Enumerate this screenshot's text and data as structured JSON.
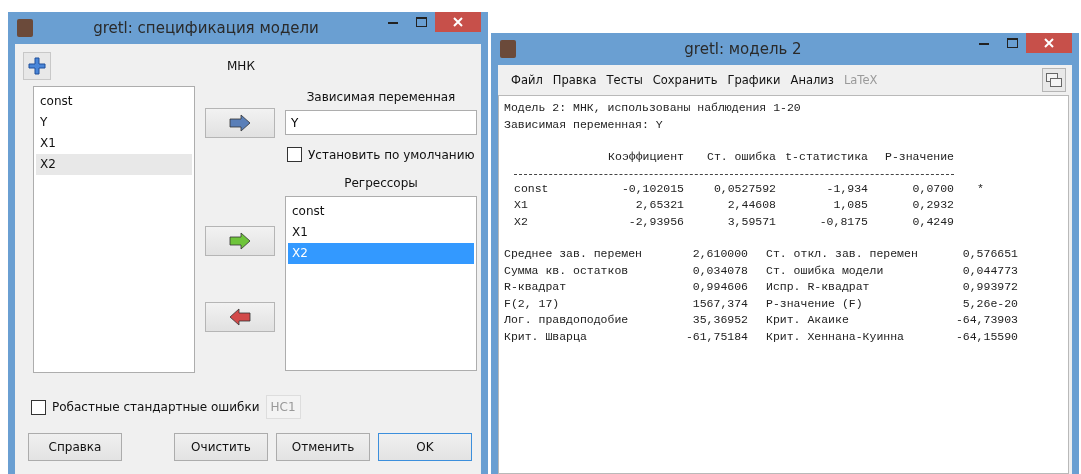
{
  "spec_window": {
    "title": "gretl: спецификация модели",
    "method": "МНК",
    "variables": [
      {
        "label": "const",
        "selected": false
      },
      {
        "label": "Y",
        "selected": false
      },
      {
        "label": "X1",
        "selected": false
      },
      {
        "label": "X2",
        "selected": true
      }
    ],
    "dependent": {
      "label": "Зависимая переменная",
      "value": "Y"
    },
    "set_default": {
      "label": "Установить по умолчанию",
      "checked": false
    },
    "regressors": {
      "label": "Регрессоры",
      "items": [
        {
          "label": "const",
          "selected": false
        },
        {
          "label": "X1",
          "selected": false
        },
        {
          "label": "X2",
          "selected": true
        }
      ]
    },
    "robust": {
      "label": "Робастные стандартные ошибки",
      "checked": false,
      "variant": "HC1",
      "variant_disabled": true
    },
    "buttons": [
      {
        "label": "Справка",
        "default": false
      },
      {
        "label": "Очистить",
        "default": false
      },
      {
        "label": "Отменить",
        "default": false
      },
      {
        "label": "OK",
        "default": true
      }
    ]
  },
  "model_window": {
    "title": "gretl: модель 2",
    "menu": [
      {
        "label": "Файл",
        "disabled": false
      },
      {
        "label": "Правка",
        "disabled": false
      },
      {
        "label": "Тесты",
        "disabled": false
      },
      {
        "label": "Сохранить",
        "disabled": false
      },
      {
        "label": "Графики",
        "disabled": false
      },
      {
        "label": "Анализ",
        "disabled": false
      },
      {
        "label": "LaTeX",
        "disabled": true
      }
    ],
    "header": [
      "Модель 2: МНК, использованы наблюдения 1-20",
      "Зависимая переменная: Y"
    ],
    "table": {
      "columns": [
        "Коэффициент",
        "Ст. ошибка",
        "t-статистика",
        "P-значение"
      ],
      "rows": [
        {
          "name": "const",
          "cells": [
            "-0,102015",
            "0,0527592",
            "-1,934",
            "0,0700"
          ],
          "stars": "*"
        },
        {
          "name": "X1",
          "cells": [
            "2,65321",
            "2,44608",
            "1,085",
            "0,2932"
          ]
        },
        {
          "name": "X2",
          "cells": [
            "-2,93956",
            "3,59571",
            "-0,8175",
            "0,4249"
          ]
        }
      ]
    },
    "stats": [
      [
        "Среднее зав. перемен",
        "2,610000",
        "Ст. откл. зав. перемен",
        "0,576651"
      ],
      [
        "Сумма кв. остатков",
        "0,034078",
        "Ст. ошибка модели",
        "0,044773"
      ],
      [
        "R-квадрат",
        "0,994606",
        "Испр. R-квадрат",
        "0,993972"
      ],
      [
        "F(2, 17)",
        "1567,374",
        "P-значение (F)",
        "5,26e-20"
      ],
      [
        "Лог. правдоподобие",
        "35,36952",
        "Крит. Акаике",
        "-64,73903"
      ],
      [
        "Крит. Шварца",
        "-61,75184",
        "Крит. Хеннана-Куинна",
        "-64,15590"
      ]
    ]
  }
}
